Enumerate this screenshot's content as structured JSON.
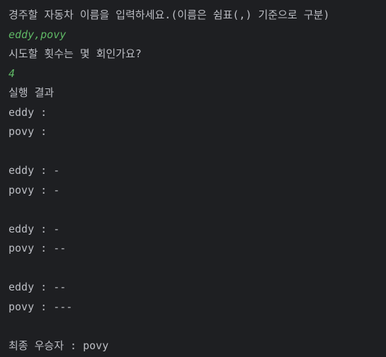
{
  "console": {
    "lines": [
      {
        "text": "경주할 자동차 이름을 입력하세요.(이름은 쉼표(,) 기준으로 구분)",
        "type": "output"
      },
      {
        "text": "eddy,povy",
        "type": "input"
      },
      {
        "text": "시도할 횟수는 몇 회인가요?",
        "type": "output"
      },
      {
        "text": "4",
        "type": "input"
      },
      {
        "text": "실행 결과",
        "type": "output"
      },
      {
        "text": "eddy : ",
        "type": "output"
      },
      {
        "text": "povy : ",
        "type": "output"
      },
      {
        "text": "",
        "type": "output"
      },
      {
        "text": "eddy : -",
        "type": "output"
      },
      {
        "text": "povy : -",
        "type": "output"
      },
      {
        "text": "",
        "type": "output"
      },
      {
        "text": "eddy : -",
        "type": "output"
      },
      {
        "text": "povy : --",
        "type": "output"
      },
      {
        "text": "",
        "type": "output"
      },
      {
        "text": "eddy : --",
        "type": "output"
      },
      {
        "text": "povy : ---",
        "type": "output"
      },
      {
        "text": "",
        "type": "output"
      },
      {
        "text": "최종 우승자 : povy",
        "type": "output"
      }
    ]
  }
}
